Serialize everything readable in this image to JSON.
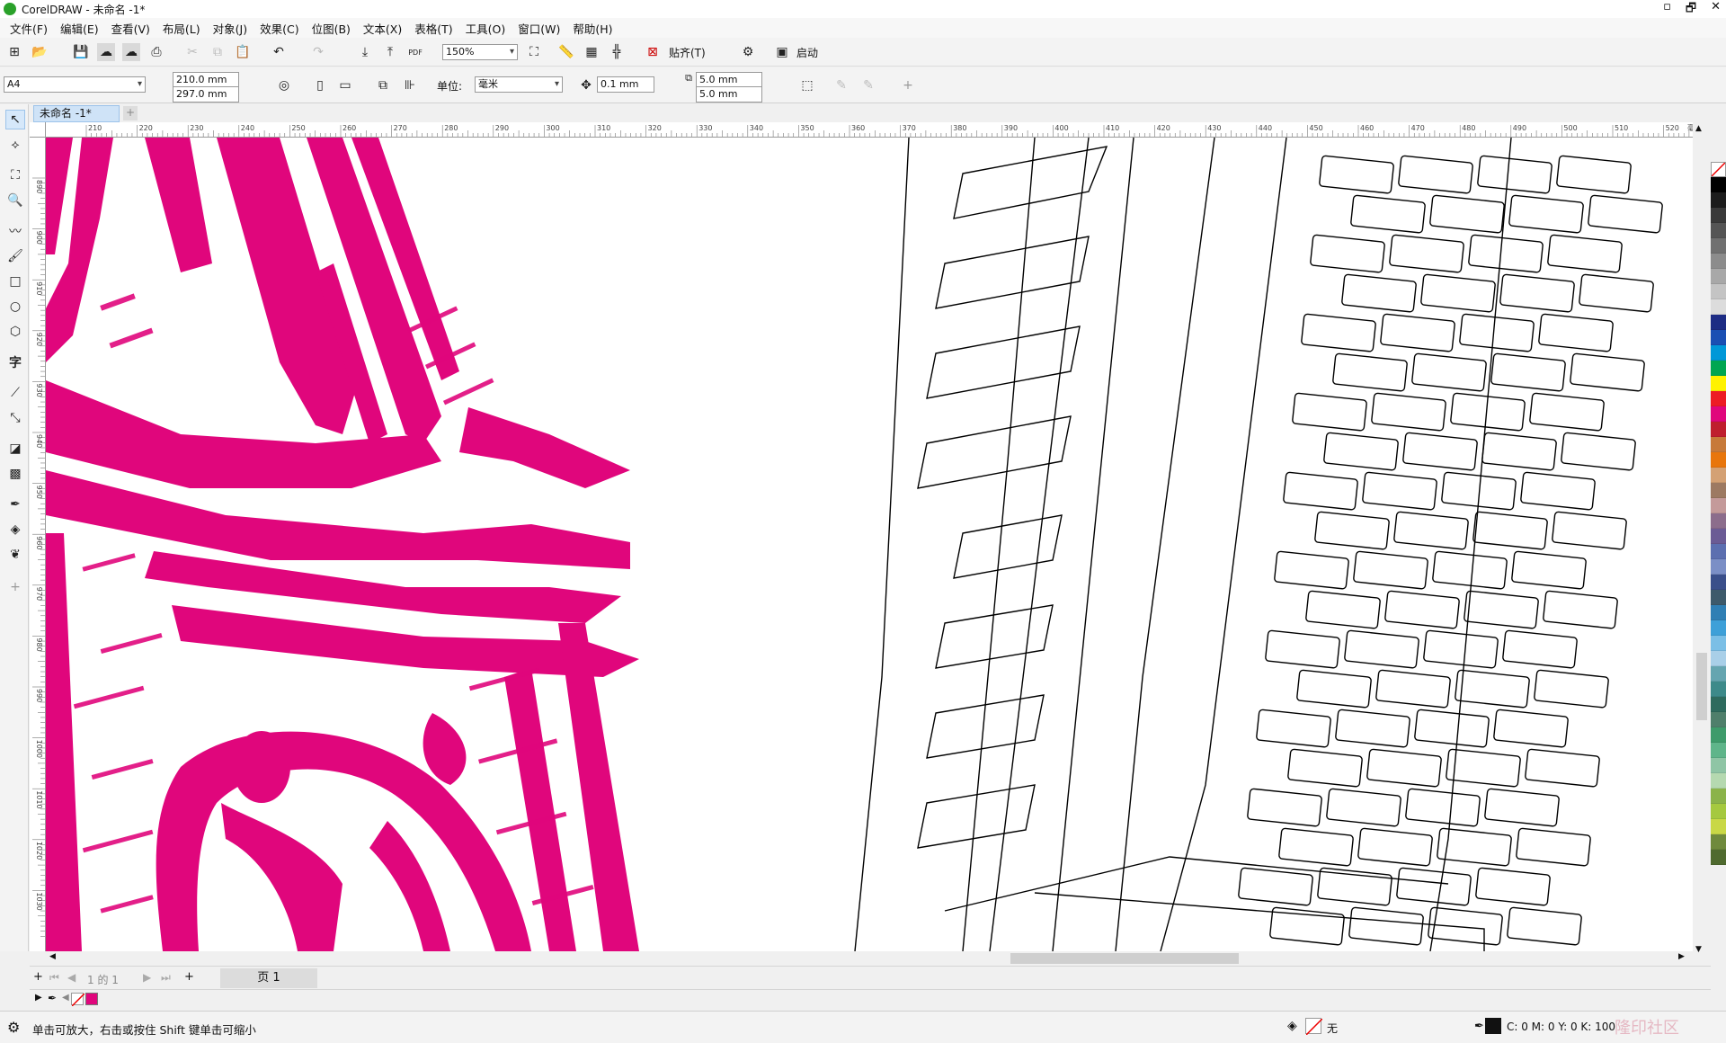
{
  "window": {
    "title": "CorelDRAW - 未命名 -1*",
    "controls": [
      "▫",
      "🗗",
      "✕"
    ]
  },
  "menu": [
    "文件(F)",
    "编辑(E)",
    "查看(V)",
    "布局(L)",
    "对象(J)",
    "效果(C)",
    "位图(B)",
    "文本(X)",
    "表格(T)",
    "工具(O)",
    "窗口(W)",
    "帮助(H)"
  ],
  "toolbar": {
    "zoom": "150%",
    "snap_label": "贴齐(T)",
    "launch_label": "启动",
    "pdf_label": "PDF"
  },
  "propertybar": {
    "page_size": "A4",
    "width": "210.0 mm",
    "height": "297.0 mm",
    "units_label": "单位:",
    "units": "毫米",
    "nudge": "0.1 mm",
    "dup_x": "5.0 mm",
    "dup_y": "5.0 mm"
  },
  "document": {
    "tab": "未命名 -1*",
    "ruler_unit": "毫米",
    "hruler_ticks": [
      "210",
      "220",
      "230",
      "240",
      "250",
      "260",
      "270",
      "280",
      "290",
      "300",
      "310",
      "320",
      "330",
      "340",
      "350",
      "360",
      "370",
      "380",
      "390",
      "400",
      "410",
      "420",
      "430",
      "440",
      "450",
      "460",
      "470",
      "480",
      "490",
      "500",
      "510",
      "520"
    ],
    "vruler_ticks": [
      "890",
      "900",
      "910",
      "920",
      "930",
      "940",
      "950",
      "960",
      "970",
      "980",
      "990",
      "1000",
      "1010",
      "1020",
      "1030"
    ],
    "artwork_color": "#e0067c"
  },
  "pages": {
    "indicator": "1 的 1",
    "tab": "页 1"
  },
  "status": {
    "hint": "单击可放大，右击或按住 Shift 键单击可缩小",
    "fill_none": "无",
    "outline_cmyk": "C: 0 M: 0 Y: 0 K: 100",
    "watermark": "隆印社区"
  },
  "palette": [
    "#ffffff",
    "#000000",
    "#1c1c1c",
    "#3a3a3a",
    "#555555",
    "#707070",
    "#8c8c8c",
    "#a8a8a8",
    "#c4c4c4",
    "#dcdcdc",
    "#1d2c84",
    "#1a4fb3",
    "#0098d8",
    "#00a651",
    "#fff200",
    "#ed1c24",
    "#e0067c",
    "#bf1e2e",
    "#c77a3a",
    "#e8760c",
    "#d4a174",
    "#9d7a62",
    "#c49a9a",
    "#8c6d8c",
    "#6b5b95",
    "#5c6fb0",
    "#7b8fc6",
    "#3a4f8a",
    "#3d5a6b",
    "#2f7fb4",
    "#3ea0d8",
    "#7bbfe6",
    "#a9cfe8",
    "#65a5b0",
    "#3d8a8a",
    "#2e6b5e",
    "#4f7f6b",
    "#3e9b6b",
    "#5fb58a",
    "#8fc5a5",
    "#b5d9b0",
    "#8bb34a",
    "#a5c93f",
    "#c9d846",
    "#6f8a3c",
    "#4f6a2f"
  ],
  "doc_palette": [
    "#e0067c"
  ]
}
